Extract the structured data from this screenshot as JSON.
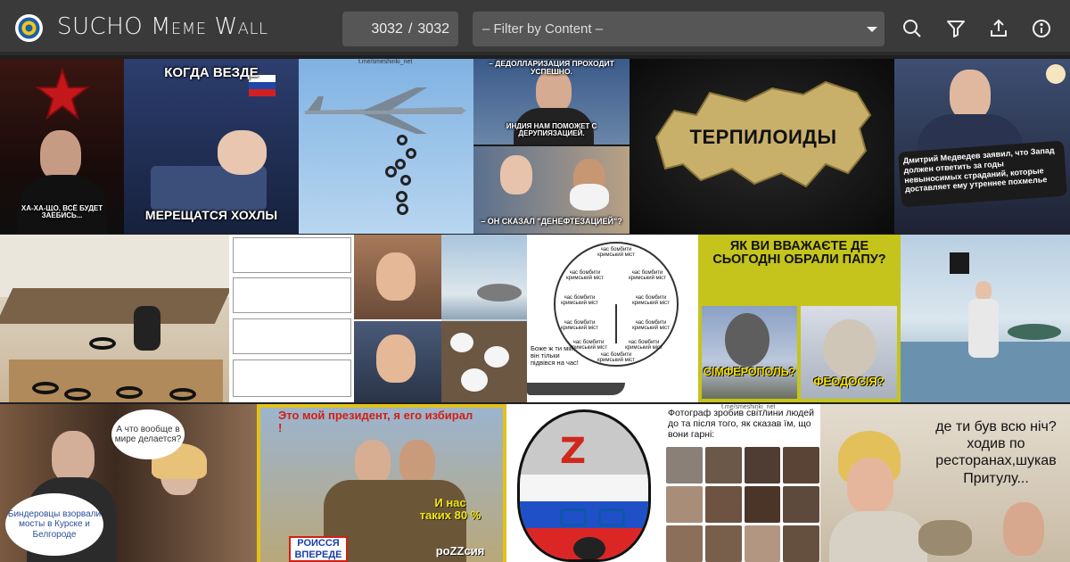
{
  "header": {
    "title": "SUCHO Meme Wall",
    "counter": {
      "current": "3032",
      "sep": "/",
      "total": "3032"
    },
    "filter_placeholder": "– Filter by Content –",
    "icons": [
      "search-icon",
      "filter-icon",
      "share-icon",
      "info-icon"
    ],
    "colors": {
      "bar": "#3a3a3a",
      "field": "#565656",
      "text": "#f2f2f2"
    }
  },
  "memes": {
    "m1": {
      "caption": "ХА-ХА-ЩО, ВСЁ БУДЕТ ЗАЕБИСЬ..."
    },
    "m2": {
      "top": "КОГДА ВЕЗДЕ",
      "bottom": "МЕРЕЩАТСЯ ХОХЛЫ",
      "credit": "t.me/smeshinki_net"
    },
    "m3": {
      "credit": "t.me/smeshinki_net"
    },
    "m4": {
      "top": "– ДЕДОЛЛАРИЗАЦИЯ ПРОХОДИТ УСПЕШНО.",
      "mid": "ИНДИЯ НАМ ПОМОЖЕТ С ДЕРУПИЯЗАЦИЕЙ.",
      "bottom": "– ОН СКАЗАЛ \"ДЕНЕФТЕЗАЦИЕЙ\"?"
    },
    "m5": {
      "label": "ТЕРПИЛОИДЫ"
    },
    "m6": {
      "caption": "Дмитрий Медведев заявил, что Запад должен ответить за годы невыносимых страданий, которые доставляет ему утреннее похмелье"
    },
    "m9": {
      "items": [
        "час бомбити кримський міст",
        "час бомбити кримський міст",
        "час бомбити кримський міст",
        "час бомбити кримський міст",
        "час бомбити кримський міст",
        "час бомбити кримський міст",
        "час бомбити кримський міст",
        "час бомбити кримський міст",
        "час бомбити кримський міст",
        "час бомбити кримський міст"
      ],
      "caption": "Боже ж ти мій, він тільки підвівся на час!"
    },
    "m10": {
      "top": "ЯК ВИ ВВАЖАЄТЕ ДЕ СЬОГОДНІ ОБРАЛИ ПАПУ?",
      "left": "СІМФЕРОПОЛЬ?",
      "right": "ФЕОДОСІЯ?"
    },
    "m12": {
      "bubble_top": "А что вообще в мире делается?",
      "bubble_bottom": "Биндеровцы взорвали мосты в Курске и Белгороде"
    },
    "m13": {
      "top": "Это мой президент, я его избирал !",
      "right": "И нас таких 80 %",
      "bottom": "роZZсия",
      "sign": "РОИССЯ ВПЕРЕДЕ"
    },
    "m15": {
      "caption": "Фотограф зробив світлини людей до та після того, як сказав їм, що вони гарні:",
      "credit": "t.me/smeshinki_net"
    },
    "m16": {
      "caption": "де ти був всю ніч? ходив по ресторанах,шукав Притулу..."
    }
  }
}
